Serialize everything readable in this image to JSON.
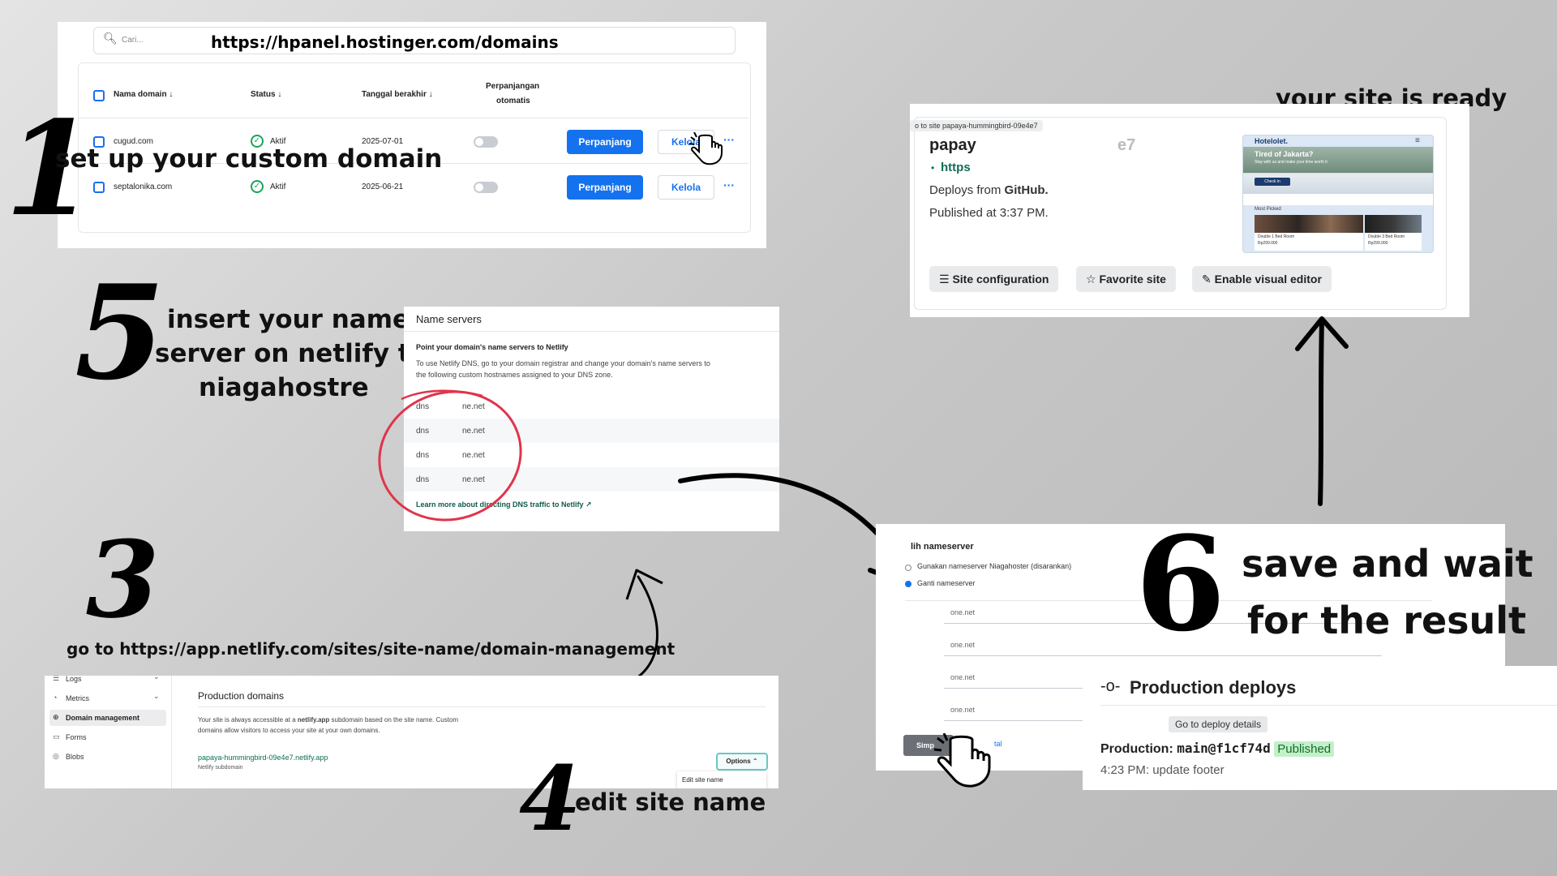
{
  "step1": {
    "search_placeholder": "Cari...",
    "url": "https://hpanel.hostinger.com/domains",
    "headers": {
      "domain": "Nama domain ↓",
      "status": "Status ↓",
      "expiry": "Tanggal berakhir ↓",
      "autorenew_l1": "Perpanjangan",
      "autorenew_l2": "otomatis"
    },
    "rows": [
      {
        "domain": "cugud.com",
        "status": "Aktif",
        "date": "2025-07-01",
        "renew": "Perpanjang",
        "manage": "Kelola",
        "more": "···"
      },
      {
        "domain": "septalonika.com",
        "status": "Aktif",
        "date": "2025-06-21",
        "renew": "Perpanjang",
        "manage": "Kelola",
        "more": "···"
      }
    ],
    "caption": "set up your custom domain",
    "number": "1"
  },
  "ready": {
    "caption": "your site is ready",
    "tooltip": "o to site papaya-hummingbird-09e4e7",
    "site_name": "papay",
    "site_name_tail": "e7",
    "url": "https",
    "deploys_prefix": "Deploys from ",
    "deploys_source": "GitHub.",
    "published": "Published at 3:37 PM.",
    "btn_config": "Site configuration",
    "btn_favorite": "Favorite site",
    "btn_visual": "Enable visual editor",
    "thumb": {
      "brand": "Hotelolet.",
      "hero_l1": "Tired of Jakarta?",
      "hero_l2": "Stay with us and make your time worth it",
      "cta": "Check in",
      "section": "Most Picked",
      "card1": "Double 1 Bed Room",
      "card1_price": "Rp299.000",
      "card2": "Double 3 Bed Room",
      "card2_price": "Rp299.000"
    }
  },
  "step5": {
    "number": "5",
    "caption_l1": "insert your name",
    "caption_l2": "server on netlify to",
    "caption_l3": "niagahostre",
    "panel_title": "Name servers",
    "subtitle": "Point your domain's name servers to Netlify",
    "desc_l1": "To use Netlify DNS, go to your domain registrar and change your domain's name servers to",
    "desc_l2": "the following custom hostnames assigned to your DNS zone.",
    "ns_prefix": [
      "dns",
      "dns",
      "dns",
      "dns"
    ],
    "ns_suffix": [
      "ne.net",
      "ne.net",
      "ne.net",
      "ne.net"
    ],
    "learn_more": "Learn more about directing DNS traffic to Netlify ↗"
  },
  "step3": {
    "number": "3",
    "caption": "go to https://app.netlify.com/sites/site-name/domain-management"
  },
  "step4": {
    "number": "4",
    "caption": "edit site name",
    "sidebar": [
      {
        "label": "Logs",
        "chev": "⌄"
      },
      {
        "label": "Metrics",
        "chev": "⌄"
      },
      {
        "label": "Domain management",
        "chev": ""
      },
      {
        "label": "Forms",
        "chev": ""
      },
      {
        "label": "Blobs",
        "chev": ""
      }
    ],
    "title": "Production domains",
    "desc_l1a": "Your site is always accessible at a ",
    "desc_l1b": "netlify.app",
    "desc_l1c": " subdomain based on the site name. Custom",
    "desc_l2": "domains allow visitors to access your site at your own domains.",
    "domain": "papaya-hummingbird-09e4e7.netlify.app",
    "domain_sub": "Netlify subdomain",
    "options": "Options ⌃",
    "menu_item": "Edit site name"
  },
  "step6": {
    "number": "6",
    "caption_l1": "save and wait",
    "caption_l2": "for the result",
    "ns_title": "lih nameserver",
    "radio1": "Gunakan nameserver Niagahoster (disarankan)",
    "radio2": "Ganti nameserver",
    "fields": [
      "one.net",
      "one.net",
      "one.net",
      "one.net"
    ],
    "save_btn": "Simp",
    "cancel_link": "tal",
    "deploys_title": "Production deploys",
    "tooltip": "Go to deploy details",
    "prod_label": "Production: ",
    "prod_commit": "main@f1cf74d",
    "badge": "Published",
    "deploy_time": "4:23 PM: update footer"
  },
  "colors": {
    "accent": "#1472ee",
    "netlify_green": "#0e6d57",
    "published_bg": "#c3f0c9",
    "annotation_red": "#e0344b"
  }
}
